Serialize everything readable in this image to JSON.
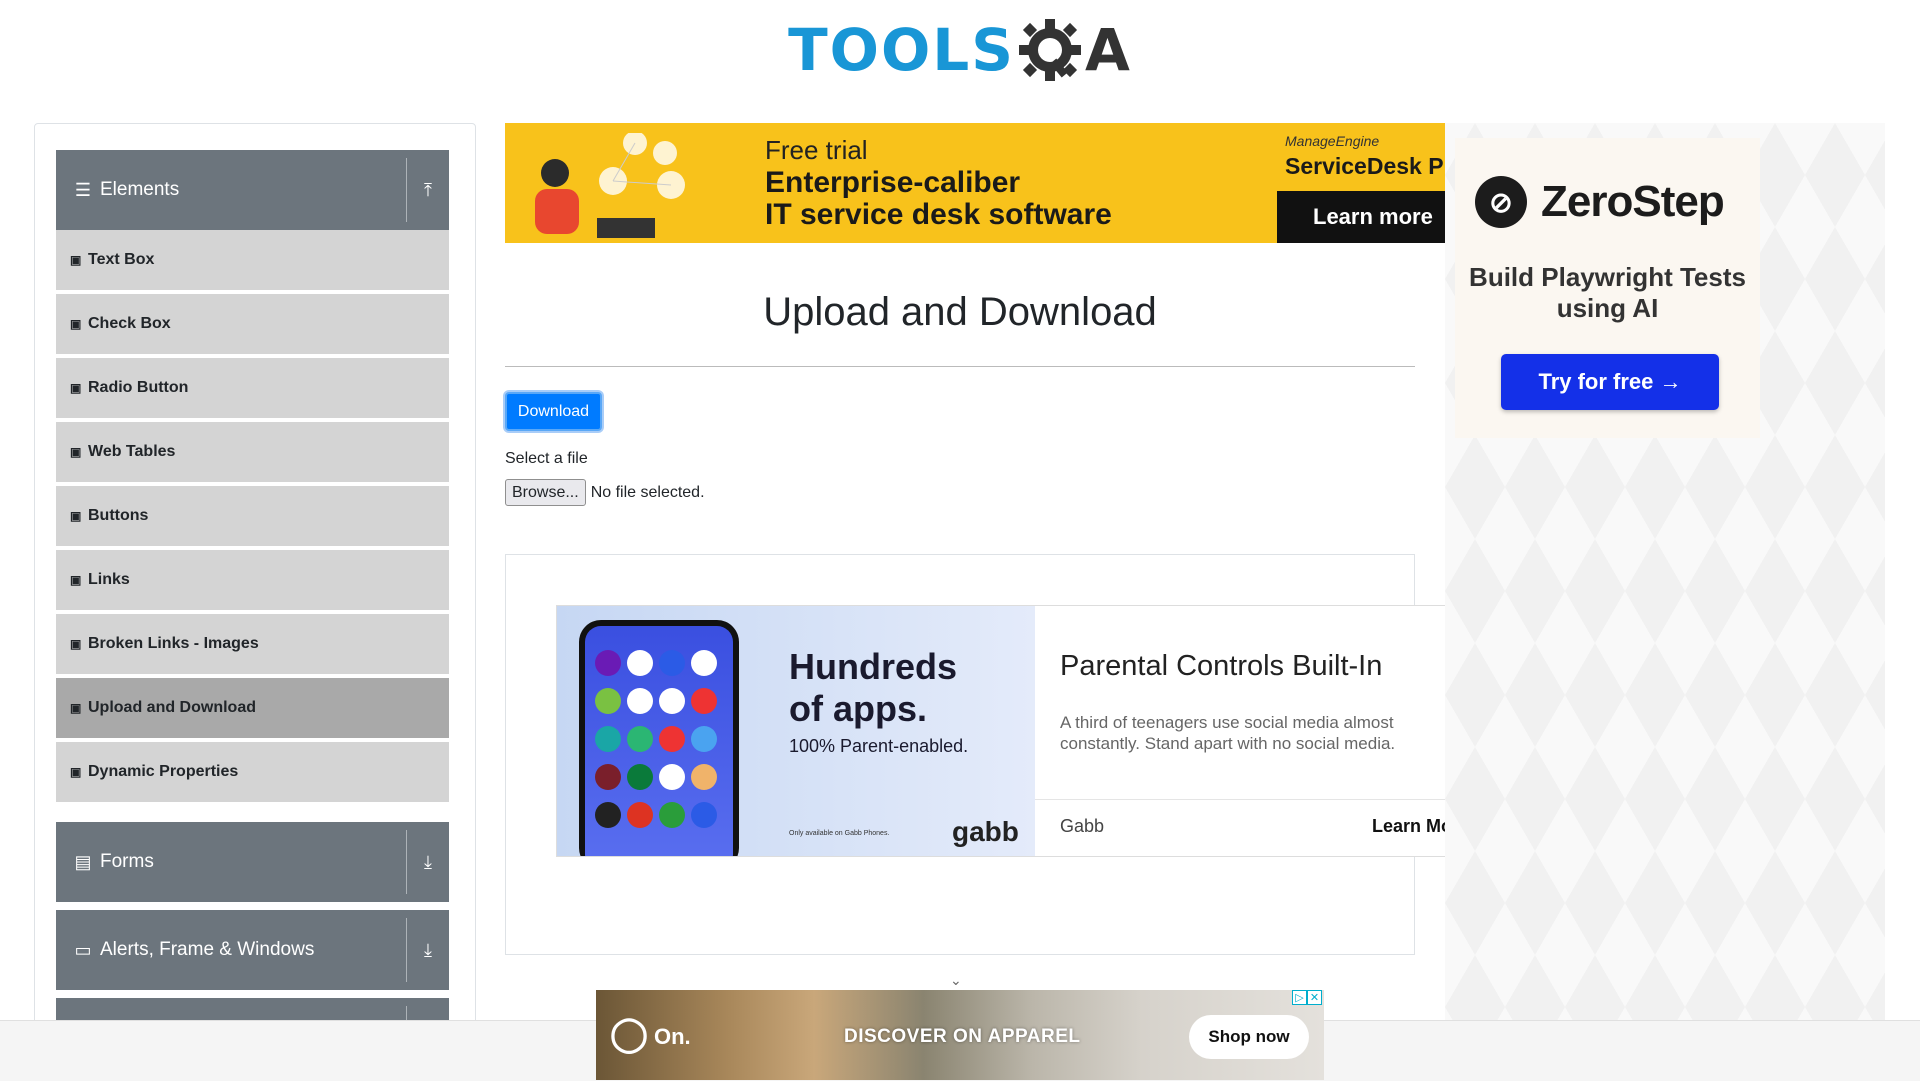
{
  "header": {
    "logo_tools": "TOOLS",
    "logo_qa": "A"
  },
  "sidebar": {
    "groups": [
      {
        "label": "Elements",
        "icon": "hamburger-icon",
        "toggle_icon": "upload-arrow-icon"
      },
      {
        "label": "Forms",
        "icon": "document-icon",
        "toggle_icon": "download-arrow-icon"
      },
      {
        "label": "Alerts, Frame & Windows",
        "icon": "window-icon",
        "toggle_icon": "download-arrow-icon"
      }
    ],
    "items": [
      {
        "label": "Text Box"
      },
      {
        "label": "Check Box"
      },
      {
        "label": "Radio Button"
      },
      {
        "label": "Web Tables"
      },
      {
        "label": "Buttons"
      },
      {
        "label": "Links"
      },
      {
        "label": "Broken Links - Images"
      },
      {
        "label": "Upload and Download",
        "active": true
      },
      {
        "label": "Dynamic Properties"
      }
    ]
  },
  "top_ad": {
    "free_trial": "Free trial",
    "line1": "Enterprise-caliber",
    "line2": "IT service desk software",
    "brand": "ManageEngine",
    "product": "ServiceDesk Plu",
    "cta": "Learn more"
  },
  "main": {
    "title": "Upload and Download",
    "download_button": "Download",
    "select_label": "Select a file",
    "browse_button": "Browse...",
    "no_file": "No file selected."
  },
  "mid_ad": {
    "headline_image": "Hundreds of apps.",
    "subline_image": "100% Parent-enabled.",
    "fine_print": "Only available on Gabb Phones.",
    "logo": "gabb",
    "headline": "Parental Controls Built-In",
    "description": "A third of teenagers use social media almost constantly. Stand apart with no social media.",
    "advertiser": "Gabb",
    "cta": "Learn Mo"
  },
  "right_ad": {
    "brand": "ZeroStep",
    "tagline": "Build Playwright Tests using AI",
    "cta": "Try for free →"
  },
  "bottom_ad": {
    "logo": "On.",
    "text": "DISCOVER ON APPAREL",
    "cta": "Shop now"
  },
  "colors": {
    "accent": "#007bff",
    "sidebar_header": "#6c757d",
    "sidebar_item": "#d4d4d4",
    "sidebar_item_active": "#a9a9a9",
    "zerostep_button": "#1430e8",
    "top_ad_bg": "#f8c21b"
  }
}
